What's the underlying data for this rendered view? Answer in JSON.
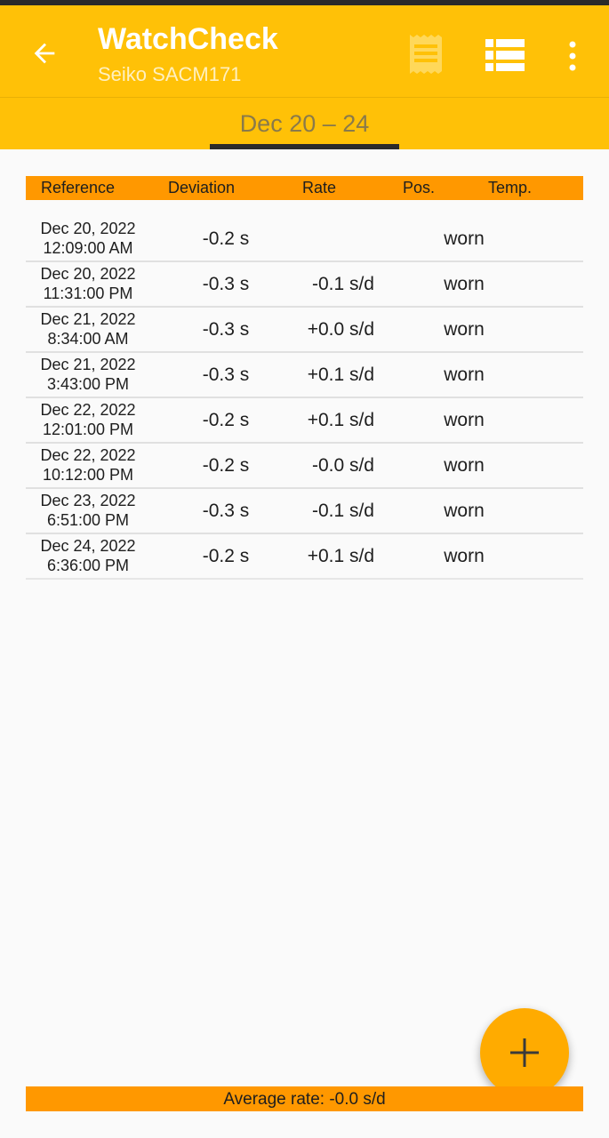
{
  "app_bar": {
    "title": "WatchCheck",
    "subtitle": "Seiko SACM171",
    "back_icon": "arrow-left-icon",
    "notes_icon": "receipt-icon",
    "list_icon": "list-view-icon",
    "menu_icon": "more-vertical-icon"
  },
  "tabs": [
    {
      "label": "Dec 20 – 24",
      "active": true
    }
  ],
  "table": {
    "headers": {
      "reference": "Reference",
      "deviation": "Deviation",
      "rate": "Rate",
      "position": "Pos.",
      "temperature": "Temp."
    },
    "rows": [
      {
        "date": "Dec 20, 2022",
        "time": "12:09:00 AM",
        "deviation": "-0.2 s",
        "rate": "",
        "position": "worn"
      },
      {
        "date": "Dec 20, 2022",
        "time": "11:31:00 PM",
        "deviation": "-0.3 s",
        "rate": "-0.1 s/d",
        "position": "worn"
      },
      {
        "date": "Dec 21, 2022",
        "time": "8:34:00 AM",
        "deviation": "-0.3 s",
        "rate": "+0.0 s/d",
        "position": "worn"
      },
      {
        "date": "Dec 21, 2022",
        "time": "3:43:00 PM",
        "deviation": "-0.3 s",
        "rate": "+0.1 s/d",
        "position": "worn"
      },
      {
        "date": "Dec 22, 2022",
        "time": "12:01:00 PM",
        "deviation": "-0.2 s",
        "rate": "+0.1 s/d",
        "position": "worn"
      },
      {
        "date": "Dec 22, 2022",
        "time": "10:12:00 PM",
        "deviation": "-0.2 s",
        "rate": "-0.0 s/d",
        "position": "worn"
      },
      {
        "date": "Dec 23, 2022",
        "time": "6:51:00 PM",
        "deviation": "-0.3 s",
        "rate": "-0.1 s/d",
        "position": "worn"
      },
      {
        "date": "Dec 24, 2022",
        "time": "6:36:00 PM",
        "deviation": "-0.2 s",
        "rate": "+0.1 s/d",
        "position": "worn"
      }
    ]
  },
  "fab": {
    "icon": "plus-icon"
  },
  "footer": {
    "average_rate": "Average rate: -0.0 s/d"
  },
  "colors": {
    "primary": "#ffc107",
    "accent": "#ff9800",
    "fab": "#ffab00"
  }
}
